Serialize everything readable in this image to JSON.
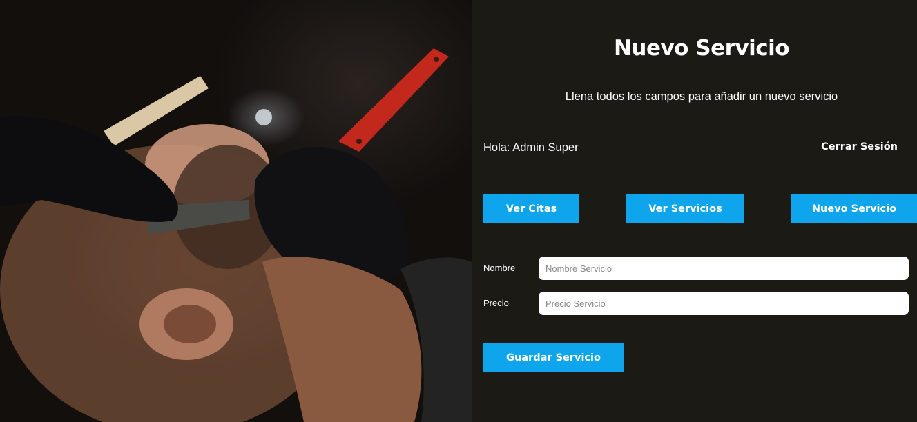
{
  "photo": {
    "alt": "barber-shaving-photo"
  },
  "header": {
    "title": "Nuevo Servicio",
    "subtitle": "Llena todos los campos para añadir un nuevo servicio"
  },
  "user": {
    "greeting": "Hola: Admin Super",
    "logout_label": "Cerrar Sesión"
  },
  "nav": {
    "citas_label": "Ver Citas",
    "servicios_label": "Ver Servicios",
    "nuevo_label": "Nuevo Servicio"
  },
  "form": {
    "nombre": {
      "label": "Nombre",
      "placeholder": "Nombre Servicio",
      "value": ""
    },
    "precio": {
      "label": "Precio",
      "placeholder": "Precio Servicio",
      "value": ""
    },
    "submit_label": "Guardar Servicio"
  },
  "colors": {
    "background": "#1b1a15",
    "accent": "#0ea5ec",
    "text": "#ffffff",
    "input_background": "#ffffff"
  }
}
